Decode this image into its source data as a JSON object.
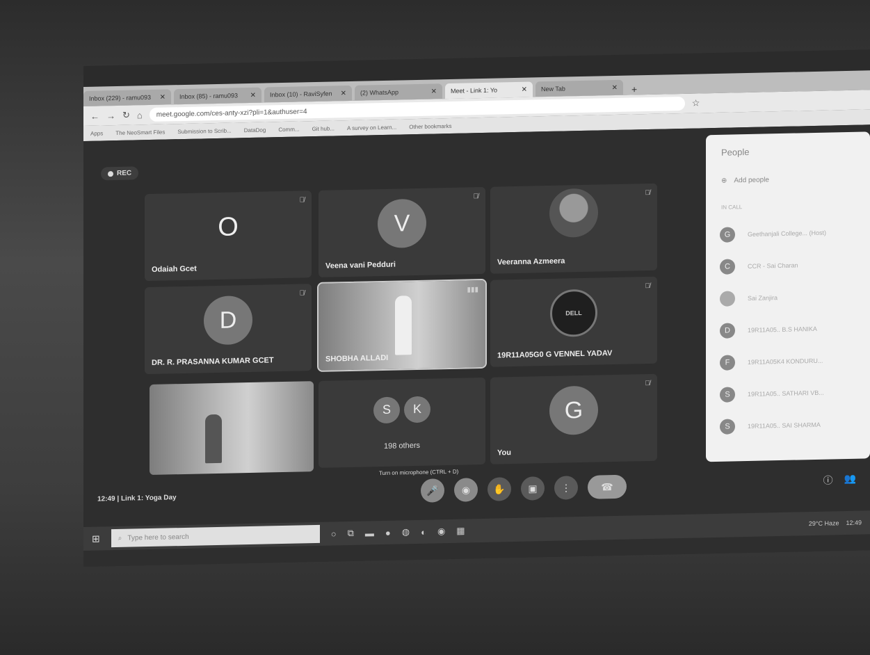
{
  "browser": {
    "tabs": [
      {
        "label": "Inbox (229) - ramu093",
        "active": false
      },
      {
        "label": "Inbox (85) - ramu093",
        "active": false
      },
      {
        "label": "Inbox (10) - RaviSyfen",
        "active": false
      },
      {
        "label": "(2) WhatsApp",
        "active": false
      },
      {
        "label": "Meet - Link 1: Yo",
        "active": true
      },
      {
        "label": "New Tab",
        "active": false
      }
    ],
    "url": "meet.google.com/ces-anty-xzi?pli=1&authuser=4",
    "bookmarks": [
      "Apps",
      "The NeoSmart Files",
      "Submission to Scrib...",
      "DataDog",
      "Comm...",
      "Git hub...",
      "A survey on Learn...",
      "Other bookmarks"
    ]
  },
  "meet": {
    "rec_label": "REC",
    "tiles": [
      {
        "name": "Odaiah Gcet",
        "avatar": "O"
      },
      {
        "name": "Veena vani Pedduri",
        "avatar": "V"
      },
      {
        "name": "Veeranna Azmeera",
        "avatar": ""
      },
      {
        "name": "DR. R. PRASANNA KUMAR GCET",
        "avatar": "D"
      },
      {
        "name": "SHOBHA ALLADI",
        "avatar": ""
      },
      {
        "name": "19R11A05G0 G VENNEL YADAV",
        "avatar": ""
      },
      {
        "name": "",
        "avatar": ""
      },
      {
        "name": "198 others",
        "avatar": ""
      },
      {
        "name": "You",
        "avatar": "G"
      }
    ],
    "others_avatars": [
      "S",
      "K"
    ],
    "tip": "Turn on microphone (CTRL + D)",
    "time": "12:49",
    "meeting_name": "Link 1: Yoga Day"
  },
  "people_panel": {
    "title": "People",
    "add_label": "Add people",
    "section_label": "IN CALL",
    "entries": [
      {
        "avatar": "G",
        "label": "Geethanjali College... (Host)"
      },
      {
        "avatar": "C",
        "label": "CCR - Sai Charan"
      },
      {
        "avatar": "",
        "label": "Sai Zanjira"
      },
      {
        "avatar": "D",
        "label": "19R11A05.. B.S HANIKA"
      },
      {
        "avatar": "F",
        "label": "19R11A05K4 KONDURU..."
      },
      {
        "avatar": "S",
        "label": "19R11A05.. SATHARI VB..."
      },
      {
        "avatar": "S",
        "label": "19R11A05.. SAI SHARMA"
      }
    ]
  },
  "taskbar": {
    "search_placeholder": "Type here to search",
    "weather": "29°C Haze",
    "time": "12:49"
  }
}
